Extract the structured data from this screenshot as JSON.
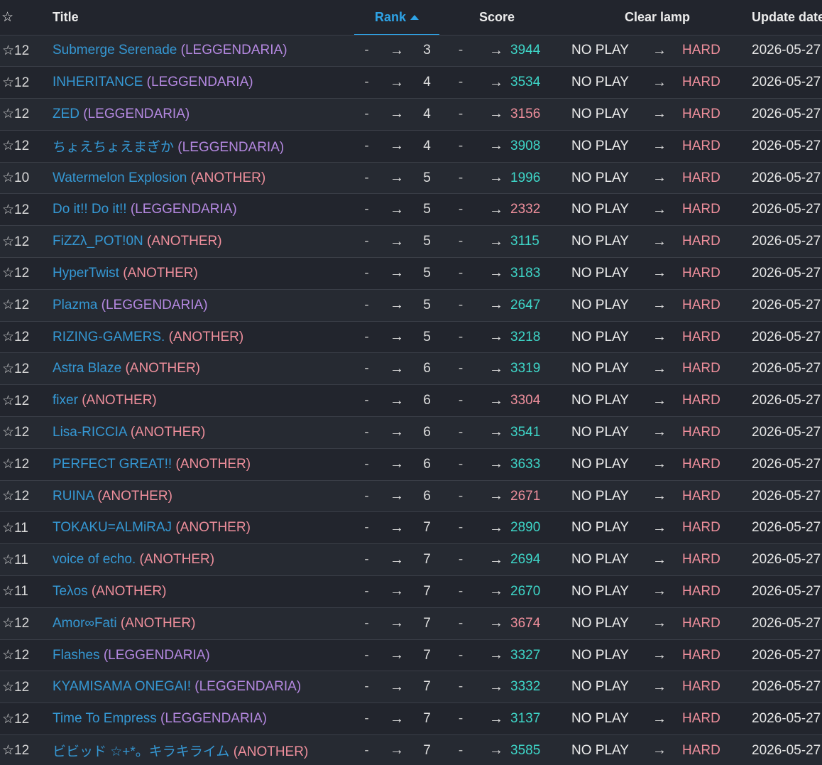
{
  "header": {
    "level_icon": "☆",
    "title": "Title",
    "rank": "Rank",
    "score": "Score",
    "clear_lamp": "Clear lamp",
    "update_date": "Update date"
  },
  "arrow": "→",
  "dash": "-",
  "rows": [
    {
      "level": "☆12",
      "title": "Submerge Serenade",
      "diff": "(LEGGENDARIA)",
      "diff_class": "leg",
      "rank": "3",
      "score": "3944",
      "score_up": true,
      "lamp_old": "NO PLAY",
      "lamp_new": "HARD",
      "date": "2026-05-27"
    },
    {
      "level": "☆12",
      "title": "INHERITANCE",
      "diff": "(LEGGENDARIA)",
      "diff_class": "leg",
      "rank": "4",
      "score": "3534",
      "score_up": true,
      "lamp_old": "NO PLAY",
      "lamp_new": "HARD",
      "date": "2026-05-27"
    },
    {
      "level": "☆12",
      "title": "ZED",
      "diff": "(LEGGENDARIA)",
      "diff_class": "leg",
      "rank": "4",
      "score": "3156",
      "score_up": false,
      "lamp_old": "NO PLAY",
      "lamp_new": "HARD",
      "date": "2026-05-27"
    },
    {
      "level": "☆12",
      "title": "ちょえちょえまぎか",
      "diff": "(LEGGENDARIA)",
      "diff_class": "leg",
      "rank": "4",
      "score": "3908",
      "score_up": true,
      "lamp_old": "NO PLAY",
      "lamp_new": "HARD",
      "date": "2026-05-27"
    },
    {
      "level": "☆10",
      "title": "Watermelon Explosion",
      "diff": "(ANOTHER)",
      "diff_class": "ano",
      "rank": "5",
      "score": "1996",
      "score_up": true,
      "lamp_old": "NO PLAY",
      "lamp_new": "HARD",
      "date": "2026-05-27"
    },
    {
      "level": "☆12",
      "title": "Do it!! Do it!!",
      "diff": "(LEGGENDARIA)",
      "diff_class": "leg",
      "rank": "5",
      "score": "2332",
      "score_up": false,
      "lamp_old": "NO PLAY",
      "lamp_new": "HARD",
      "date": "2026-05-27"
    },
    {
      "level": "☆12",
      "title": "FiZZλ_POT!0N",
      "diff": "(ANOTHER)",
      "diff_class": "ano",
      "rank": "5",
      "score": "3115",
      "score_up": true,
      "lamp_old": "NO PLAY",
      "lamp_new": "HARD",
      "date": "2026-05-27"
    },
    {
      "level": "☆12",
      "title": "HyperTwist",
      "diff": "(ANOTHER)",
      "diff_class": "ano",
      "rank": "5",
      "score": "3183",
      "score_up": true,
      "lamp_old": "NO PLAY",
      "lamp_new": "HARD",
      "date": "2026-05-27"
    },
    {
      "level": "☆12",
      "title": "Plazma",
      "diff": "(LEGGENDARIA)",
      "diff_class": "leg",
      "rank": "5",
      "score": "2647",
      "score_up": true,
      "lamp_old": "NO PLAY",
      "lamp_new": "HARD",
      "date": "2026-05-27"
    },
    {
      "level": "☆12",
      "title": "RIZING-GAMERS.",
      "diff": "(ANOTHER)",
      "diff_class": "ano",
      "rank": "5",
      "score": "3218",
      "score_up": true,
      "lamp_old": "NO PLAY",
      "lamp_new": "HARD",
      "date": "2026-05-27"
    },
    {
      "level": "☆12",
      "title": "Astra Blaze",
      "diff": "(ANOTHER)",
      "diff_class": "ano",
      "rank": "6",
      "score": "3319",
      "score_up": true,
      "lamp_old": "NO PLAY",
      "lamp_new": "HARD",
      "date": "2026-05-27"
    },
    {
      "level": "☆12",
      "title": "fixer",
      "diff": "(ANOTHER)",
      "diff_class": "ano",
      "rank": "6",
      "score": "3304",
      "score_up": false,
      "lamp_old": "NO PLAY",
      "lamp_new": "HARD",
      "date": "2026-05-27"
    },
    {
      "level": "☆12",
      "title": "Lisa-RICCIA",
      "diff": "(ANOTHER)",
      "diff_class": "ano",
      "rank": "6",
      "score": "3541",
      "score_up": true,
      "lamp_old": "NO PLAY",
      "lamp_new": "HARD",
      "date": "2026-05-27"
    },
    {
      "level": "☆12",
      "title": "PERFECT GREAT!!",
      "diff": "(ANOTHER)",
      "diff_class": "ano",
      "rank": "6",
      "score": "3633",
      "score_up": true,
      "lamp_old": "NO PLAY",
      "lamp_new": "HARD",
      "date": "2026-05-27"
    },
    {
      "level": "☆12",
      "title": "RUINA",
      "diff": "(ANOTHER)",
      "diff_class": "ano",
      "rank": "6",
      "score": "2671",
      "score_up": false,
      "lamp_old": "NO PLAY",
      "lamp_new": "HARD",
      "date": "2026-05-27"
    },
    {
      "level": "☆11",
      "title": "TOKAKU=ALMiRAJ",
      "diff": "(ANOTHER)",
      "diff_class": "ano",
      "rank": "7",
      "score": "2890",
      "score_up": true,
      "lamp_old": "NO PLAY",
      "lamp_new": "HARD",
      "date": "2026-05-27"
    },
    {
      "level": "☆11",
      "title": "voice of echo.",
      "diff": "(ANOTHER)",
      "diff_class": "ano",
      "rank": "7",
      "score": "2694",
      "score_up": true,
      "lamp_old": "NO PLAY",
      "lamp_new": "HARD",
      "date": "2026-05-27"
    },
    {
      "level": "☆11",
      "title": "Teλos",
      "diff": "(ANOTHER)",
      "diff_class": "ano",
      "rank": "7",
      "score": "2670",
      "score_up": true,
      "lamp_old": "NO PLAY",
      "lamp_new": "HARD",
      "date": "2026-05-27"
    },
    {
      "level": "☆12",
      "title": "Amor∞Fati",
      "diff": "(ANOTHER)",
      "diff_class": "ano",
      "rank": "7",
      "score": "3674",
      "score_up": false,
      "lamp_old": "NO PLAY",
      "lamp_new": "HARD",
      "date": "2026-05-27"
    },
    {
      "level": "☆12",
      "title": "Flashes",
      "diff": "(LEGGENDARIA)",
      "diff_class": "leg",
      "rank": "7",
      "score": "3327",
      "score_up": true,
      "lamp_old": "NO PLAY",
      "lamp_new": "HARD",
      "date": "2026-05-27"
    },
    {
      "level": "☆12",
      "title": "KYAMISAMA ONEGAI!",
      "diff": "(LEGGENDARIA)",
      "diff_class": "leg",
      "rank": "7",
      "score": "3332",
      "score_up": true,
      "lamp_old": "NO PLAY",
      "lamp_new": "HARD",
      "date": "2026-05-27"
    },
    {
      "level": "☆12",
      "title": "Time To Empress",
      "diff": "(LEGGENDARIA)",
      "diff_class": "leg",
      "rank": "7",
      "score": "3137",
      "score_up": true,
      "lamp_old": "NO PLAY",
      "lamp_new": "HARD",
      "date": "2026-05-27"
    },
    {
      "level": "☆12",
      "title": "ビビッド ☆+*。キラキライム",
      "diff": "(ANOTHER)",
      "diff_class": "ano",
      "rank": "7",
      "score": "3585",
      "score_up": true,
      "lamp_old": "NO PLAY",
      "lamp_new": "HARD",
      "date": "2026-05-27"
    }
  ],
  "colors": {
    "background": "#22252d",
    "accent": "#2ea3e6",
    "title_link": "#3598d4",
    "leggendaria": "#b488e0",
    "another": "#ef8f9c",
    "score_up": "#3ed6c8",
    "score_down": "#ef8f9c",
    "hard_lamp": "#ef8f9c"
  }
}
